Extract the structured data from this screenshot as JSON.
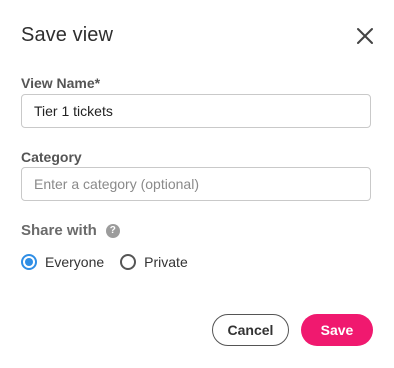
{
  "dialog": {
    "title": "Save view",
    "close_icon": "close-icon"
  },
  "fields": {
    "view_name": {
      "label": "View Name*",
      "value": "Tier 1 tickets",
      "placeholder": ""
    },
    "category": {
      "label": "Category",
      "value": "",
      "placeholder": "Enter a category (optional)"
    }
  },
  "share": {
    "label": "Share with",
    "help_icon": "help-icon",
    "help_glyph": "?",
    "options": [
      {
        "label": "Everyone",
        "selected": true
      },
      {
        "label": "Private",
        "selected": false
      }
    ]
  },
  "actions": {
    "cancel_label": "Cancel",
    "save_label": "Save"
  },
  "colors": {
    "accent": "#2f8ee5",
    "save_button": "#f0196f"
  }
}
